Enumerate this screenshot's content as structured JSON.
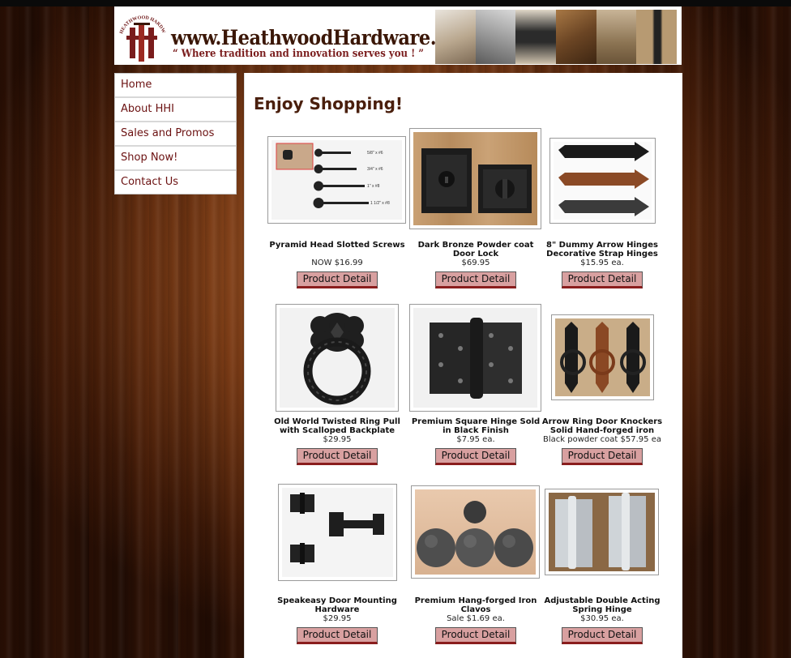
{
  "header": {
    "site_title": "www.HeathwoodHardware.com",
    "tagline": "“ Where tradition and innovation serves you ! ”",
    "logo_text": "HEATHWOOD HARDWARE INC",
    "logo_icon": "hh-monogram-logo"
  },
  "nav": {
    "items": [
      {
        "label": "Home"
      },
      {
        "label": "About HHI"
      },
      {
        "label": "Sales and Promos"
      },
      {
        "label": "Shop Now!"
      },
      {
        "label": "Contact Us"
      }
    ]
  },
  "main": {
    "title": "Enjoy Shopping!",
    "detail_label": "Product Detail",
    "products": [
      {
        "name": "Pyramid Head Slotted Screws",
        "price": "NOW $16.99",
        "image": "screws-image"
      },
      {
        "name": "Dark Bronze Powder coat Door Lock",
        "price": "$69.95",
        "image": "door-lock-image"
      },
      {
        "name": "8\" Dummy Arrow Hinges Decorative Strap Hinges",
        "price": "$15.95 ea.",
        "image": "arrow-hinges-image"
      },
      {
        "name": "Old World Twisted Ring Pull with Scalloped Backplate",
        "price": "$29.95",
        "image": "ring-pull-image"
      },
      {
        "name": "Premium Square Hinge Sold in Black Finish",
        "price": "$7.95 ea.",
        "image": "square-hinge-image"
      },
      {
        "name": "Arrow Ring Door Knockers Solid Hand-forged iron",
        "price": "Black powder coat $57.95 ea",
        "image": "door-knockers-image"
      },
      {
        "name": "Speakeasy Door Mounting Hardware",
        "price": "$29.95",
        "image": "speakeasy-hardware-image"
      },
      {
        "name": "Premium Hang-forged Iron Clavos",
        "price": "Sale $1.69 ea.",
        "image": "clavos-image"
      },
      {
        "name": "Adjustable Double Acting Spring Hinge",
        "price": "$30.95 ea.",
        "image": "spring-hinge-image"
      }
    ]
  },
  "colors": {
    "nav_text": "#6b1111",
    "title": "#4a1f0d",
    "button_bg": "#d8a0a0",
    "button_accent": "#8a1d1d"
  }
}
